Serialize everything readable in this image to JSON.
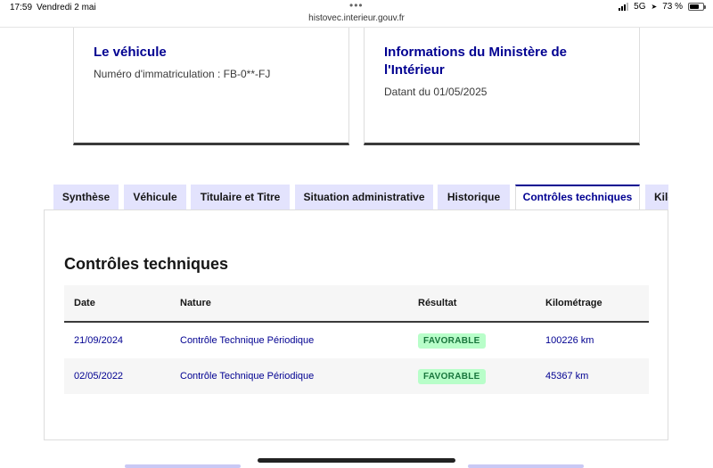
{
  "status_bar": {
    "time": "17:59",
    "date": "Vendredi 2 mai",
    "url": "histovec.interieur.gouv.fr",
    "network": "5G",
    "battery": "73 %",
    "battery_level": 0.73
  },
  "vehicle_card": {
    "title": "Le véhicule",
    "registration": "Numéro d'immatriculation : FB-0**-FJ"
  },
  "ministry_card": {
    "title_line1": "Informations du Ministère de",
    "title_line2": "l'Intérieur",
    "date_text": "Datant du 01/05/2025"
  },
  "tabs": [
    {
      "label": "Synthèse"
    },
    {
      "label": "Véhicule"
    },
    {
      "label": "Titulaire et Titre"
    },
    {
      "label": "Situation administrative"
    },
    {
      "label": "Historique"
    },
    {
      "label": "Contrôles techniques"
    },
    {
      "label": "Kilométrage"
    }
  ],
  "active_tab": "Contrôles techniques",
  "section_title": "Contrôles techniques",
  "table": {
    "headers": {
      "date": "Date",
      "nature": "Nature",
      "result": "Résultat",
      "mileage": "Kilométrage"
    },
    "rows": [
      {
        "date": "21/09/2024",
        "nature": "Contrôle Technique Périodique",
        "result": "FAVORABLE",
        "mileage": "100226 km"
      },
      {
        "date": "02/05/2022",
        "nature": "Contrôle Technique Périodique",
        "result": "FAVORABLE",
        "mileage": "45367 km"
      }
    ]
  },
  "colors": {
    "primary": "#000091",
    "tab_background": "#e3e3fd",
    "badge_background": "#b8fec9",
    "badge_text": "#18753c"
  }
}
